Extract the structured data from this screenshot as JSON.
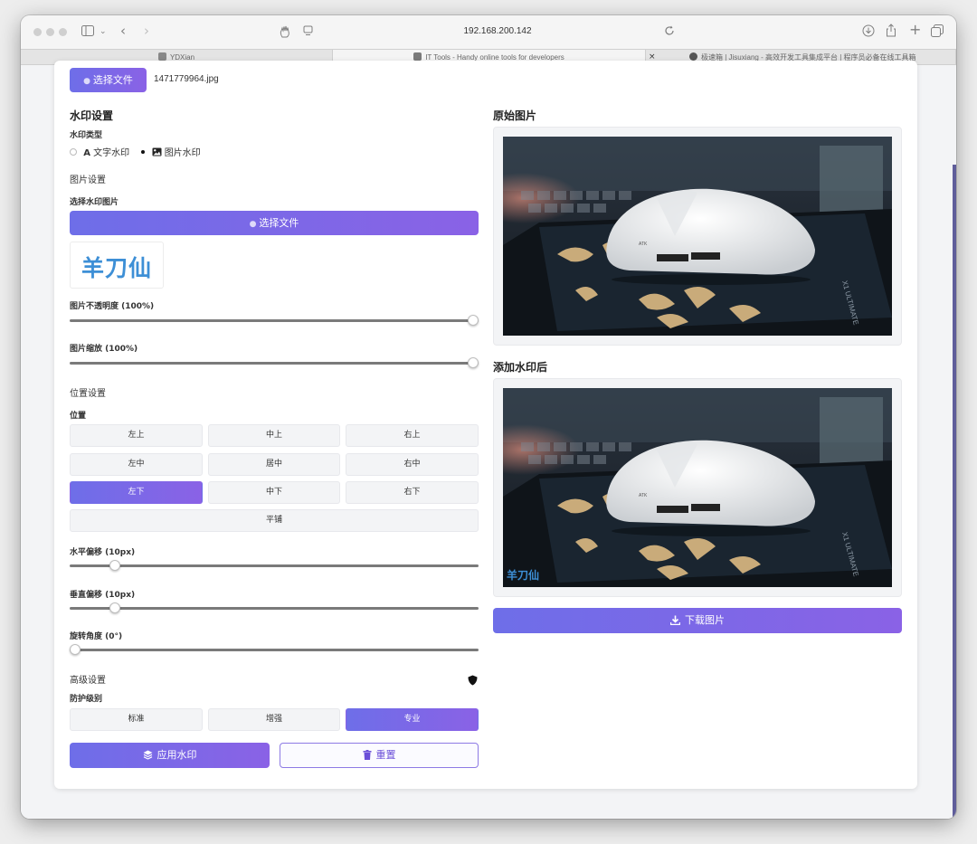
{
  "browser": {
    "url": "192.168.200.142",
    "tabs": [
      {
        "label": "YDXian"
      },
      {
        "label": "IT Tools - Handy online tools for developers"
      },
      {
        "label": "极速箱 | Jisuxiang - 高效开发工具集成平台 | 程序员必备在线工具箱"
      }
    ],
    "close_glyph": "×"
  },
  "upload": {
    "button_label": "选择文件",
    "file_name": "1471779964.jpg"
  },
  "watermark_settings": {
    "title": "水印设置",
    "type_label": "水印类型",
    "type_options": [
      {
        "label": "文字水印",
        "icon": "text-A-icon",
        "selected": false
      },
      {
        "label": "图片水印",
        "icon": "image-icon",
        "selected": true
      }
    ],
    "image_settings_title": "图片设置",
    "choose_wm_label": "选择水印图片",
    "choose_wm_button": "选择文件",
    "wm_preview_text": "羊刀仙",
    "opacity_label": "图片不透明度 (100%)",
    "opacity_value": 1.0,
    "scale_label": "图片缩放 (100%)",
    "scale_value": 1.0
  },
  "position_settings": {
    "title": "位置设置",
    "position_label": "位置",
    "positions": [
      "左上",
      "中上",
      "右上",
      "左中",
      "居中",
      "右中",
      "左下",
      "中下",
      "右下"
    ],
    "selected_position": "左下",
    "tile_label": "平铺",
    "h_offset_label": "水平偏移 (10px)",
    "h_offset_fraction": 0.1,
    "v_offset_label": "垂直偏移 (10px)",
    "v_offset_fraction": 0.1,
    "rotation_label": "旋转角度 (0°)",
    "rotation_fraction": 0.0
  },
  "advanced": {
    "title": "高级设置",
    "protection_label": "防护级别",
    "levels": [
      "标准",
      "增强",
      "专业"
    ],
    "selected_level": "专业",
    "shield_icon": "shield-icon"
  },
  "actions": {
    "apply_label": "应用水印",
    "reset_label": "重置",
    "download_label": "下载图片"
  },
  "preview": {
    "original_title": "原始图片",
    "result_title": "添加水印后",
    "watermark_overlay_text": "羊刀仙",
    "mouse_brand": "ATK",
    "mat_text": "X1 ULTIMATE"
  },
  "colors": {
    "accent_start": "#6e6ee8",
    "accent_end": "#8a62e6",
    "reset_text": "#6a4fd8"
  }
}
